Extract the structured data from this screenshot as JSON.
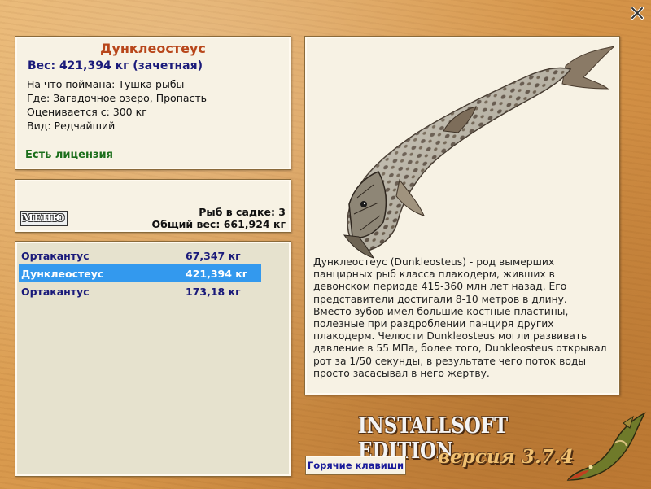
{
  "window": {
    "close_icon": "close-icon"
  },
  "fish_info": {
    "name": "Дунклеостеус",
    "weight_line": "Вес: 421,394 кг (зачетная)",
    "bait": "На что поймана: Тушка рыбы",
    "location": "Где: Загадочное озеро, Пропасть",
    "rated_from": "Оценивается с: 300 кг",
    "kind": "Вид: Редчайший",
    "license": "Есть лицензия"
  },
  "menu": {
    "button_label": "МЕНЮ",
    "fish_in_cage": "Рыб в садке: 3",
    "total_weight": "Общий вес: 661,924 кг"
  },
  "catch_list": [
    {
      "name": "Ортакантус",
      "weight": "67,347 кг",
      "selected": false
    },
    {
      "name": "Дунклеостеус",
      "weight": "421,394 кг",
      "selected": true
    },
    {
      "name": "Ортакантус",
      "weight": "173,18 кг",
      "selected": false
    }
  ],
  "description": "Дунклеостеус (Dunkleosteus) - род вымерших панцирных рыб класса плакодерм, живших в девонском периоде 415-360 млн лет назад. Его представители достигали 8-10 метров в длину. Вместо зубов имел большие костные пластины, полезные при раздроблении панциря других плакодерм. Челюсти Dunkleosteus могли развивать давление в 55 МПа, более того, Dunkleosteus открывал рот за 1/50 секунды, в результате чего поток воды просто засасывал в него жертву.",
  "footer": {
    "hotkeys_label": "Горячие клавиши",
    "brand_title": "INSTALLSOFT EDITION",
    "version": "версия 3.7.4"
  },
  "colors": {
    "title": "#b8461a",
    "weight": "#1a1a7a",
    "license": "#1b6e1b",
    "selection": "#3399ee",
    "panel": "#f7f2e4",
    "background": "#d99a4e"
  }
}
